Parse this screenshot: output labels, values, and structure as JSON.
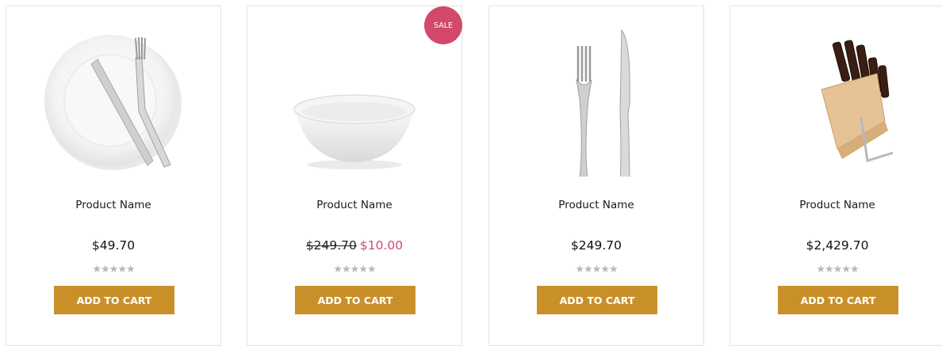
{
  "products": [
    {
      "name": "Product Name",
      "price": "$49.70",
      "rating": 0,
      "button": "ADD TO CART",
      "image": "plate-fork-knife"
    },
    {
      "name": "Product Name",
      "old_price": "$249.70",
      "sale_price": "$10.00",
      "badge": "SALE",
      "rating": 0,
      "button": "ADD TO CART",
      "image": "white-bowl"
    },
    {
      "name": "Product Name",
      "price": "$249.70",
      "rating": 0,
      "button": "ADD TO CART",
      "image": "fork-knife"
    },
    {
      "name": "Product Name",
      "price": "$2,429.70",
      "rating": 0,
      "button": "ADD TO CART",
      "image": "knife-block"
    }
  ],
  "colors": {
    "accent": "#c9902a",
    "sale": "#d2496a",
    "stars": "#b8b8b8"
  },
  "stars_glyph": "★★★★★"
}
